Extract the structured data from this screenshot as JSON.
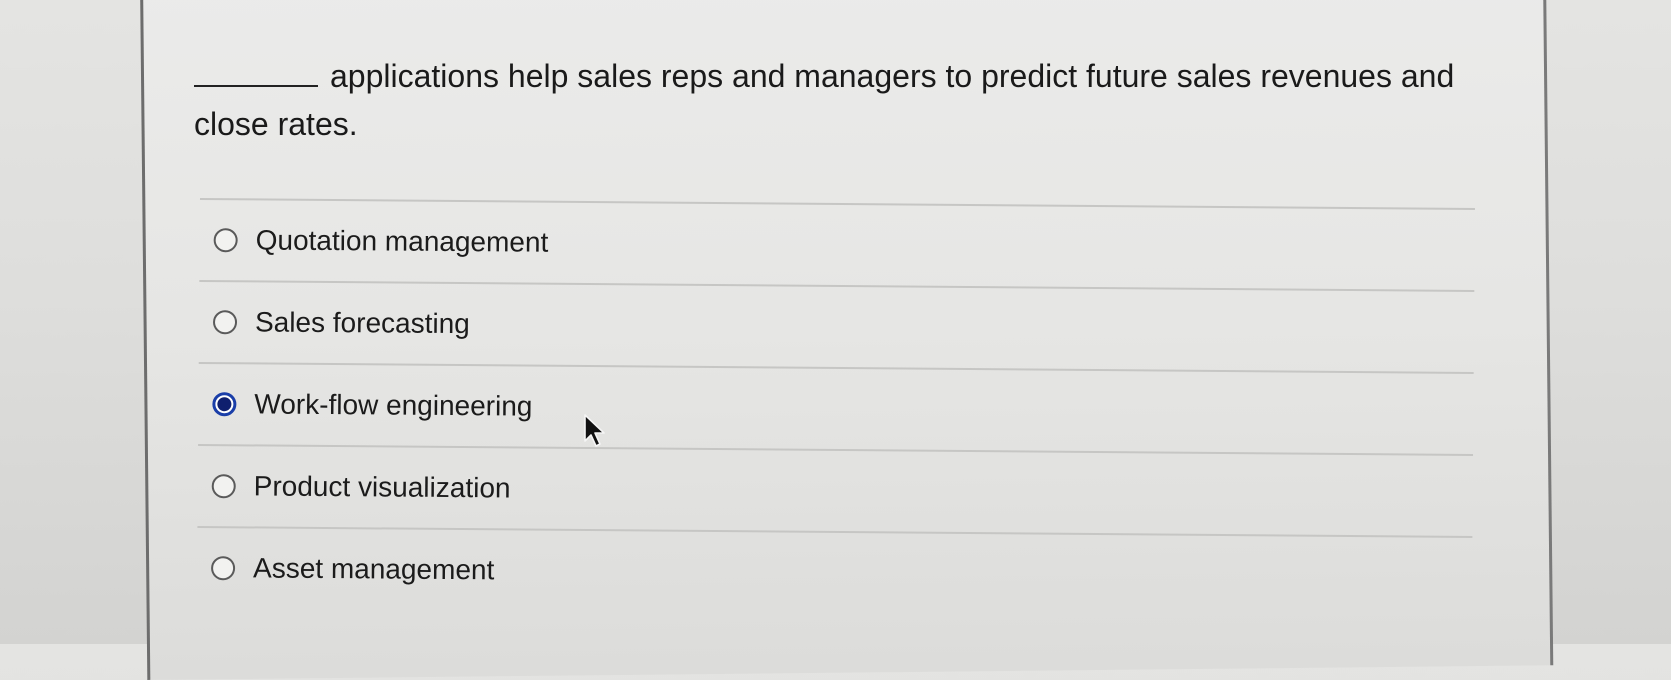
{
  "question": {
    "blank": "_______",
    "text": "applications help sales reps and managers to predict future sales revenues and close rates."
  },
  "options": [
    {
      "label": "Quotation management",
      "selected": false
    },
    {
      "label": "Sales forecasting",
      "selected": false
    },
    {
      "label": "Work-flow engineering",
      "selected": true
    },
    {
      "label": "Product visualization",
      "selected": false
    },
    {
      "label": "Asset management",
      "selected": false
    }
  ],
  "icons": {
    "radio_unselected": "radio-empty-icon",
    "radio_selected": "radio-filled-icon",
    "cursor": "mouse-pointer-icon"
  },
  "colors": {
    "selected_ring": "#1a3ea8",
    "selected_dot": "#0f1f6e",
    "divider": "#c6c6c4",
    "background": "#e4e4e2"
  }
}
